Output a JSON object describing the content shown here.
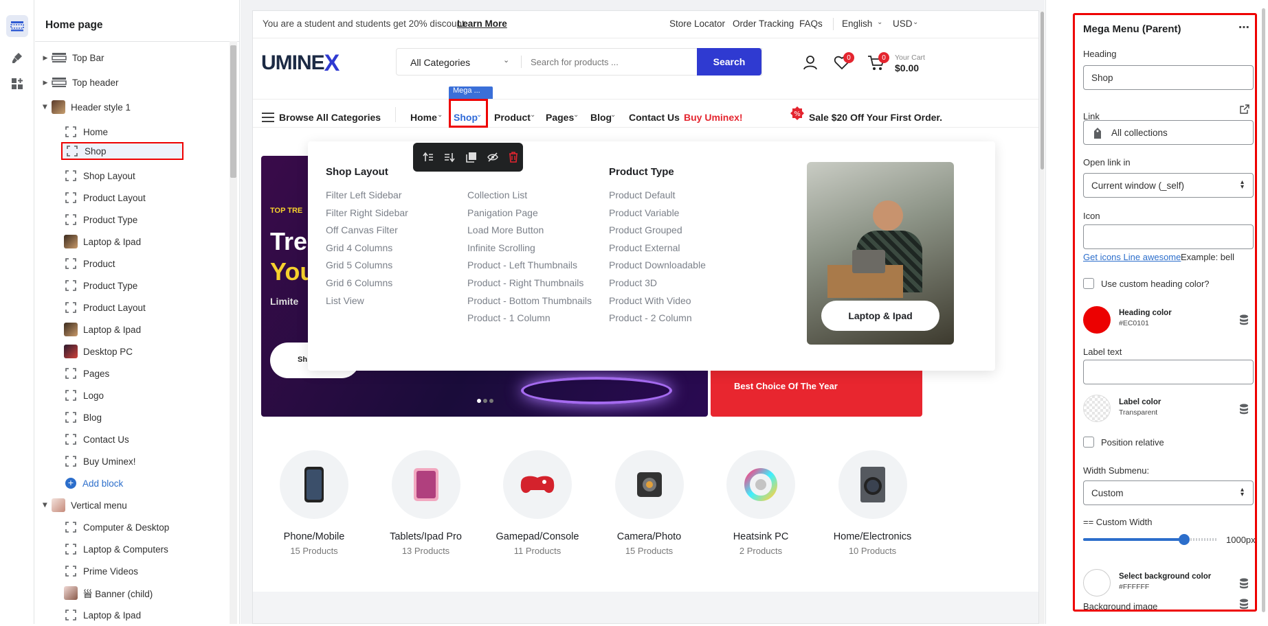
{
  "rail": {
    "icons": [
      "sections-icon",
      "theme-brush-icon",
      "apps-icon"
    ]
  },
  "tree": {
    "title": "Home page",
    "items": [
      {
        "label": "Top Bar",
        "type": "section"
      },
      {
        "label": "Top header",
        "type": "section"
      },
      {
        "label": "Header style 1",
        "type": "section-open"
      },
      {
        "label": "Home",
        "type": "block"
      },
      {
        "label": "Shop",
        "type": "block"
      },
      {
        "label": "Shop Layout",
        "type": "block"
      },
      {
        "label": "Product Layout",
        "type": "block"
      },
      {
        "label": "Product Type",
        "type": "block"
      },
      {
        "label": "Laptop & Ipad",
        "type": "image"
      },
      {
        "label": "Product",
        "type": "block"
      },
      {
        "label": "Product Type",
        "type": "block"
      },
      {
        "label": "Product Layout",
        "type": "block"
      },
      {
        "label": "Laptop & Ipad",
        "type": "image"
      },
      {
        "label": "Desktop PC",
        "type": "image"
      },
      {
        "label": "Pages",
        "type": "block"
      },
      {
        "label": "Logo",
        "type": "block"
      },
      {
        "label": "Blog",
        "type": "block"
      },
      {
        "label": "Contact Us",
        "type": "block"
      },
      {
        "label": "Buy Uminex!",
        "type": "block"
      },
      {
        "label": "Add block",
        "type": "add"
      },
      {
        "label": "Vertical menu",
        "type": "section-open"
      },
      {
        "label": "Computer & Desktop",
        "type": "block"
      },
      {
        "label": "Laptop & Computers",
        "type": "block"
      },
      {
        "label": "Prime Videos",
        "type": "block"
      },
      {
        "label": "⻡ Banner (child)",
        "type": "image"
      },
      {
        "label": "Laptop & Ipad",
        "type": "block"
      }
    ]
  },
  "store": {
    "topbar": {
      "promo": "You are a student and students get 20% discount.",
      "learn_more": "Learn More",
      "links": [
        "Store Locator",
        "Order Tracking",
        "FAQs"
      ],
      "language": "English",
      "currency": "USD"
    },
    "header": {
      "logo_left": "UMINE",
      "logo_right": "X",
      "category_select": "All Categories",
      "search_placeholder": "Search for products ...",
      "search_button": "Search",
      "wishlist_count": "0",
      "cart_count": "0",
      "cart_label": "Your Cart",
      "cart_total": "$0.00",
      "mega_tag": "Mega ..."
    },
    "nav": {
      "browse": "Browse All Categories",
      "items": [
        "Home",
        "Shop",
        "Product",
        "Pages",
        "Blog",
        "Contact Us",
        "Buy Uminex!"
      ],
      "sale": "Sale $20 Off Your First Order."
    },
    "mega": {
      "columns": [
        {
          "heading": "Shop Layout",
          "items": [
            "Filter Left Sidebar",
            "Filter Right Sidebar",
            "Off Canvas Filter",
            "Grid 4 Columns",
            "Grid 5 Columns",
            "Grid 6 Columns",
            "List View"
          ]
        },
        {
          "heading": "",
          "items": [
            "Collection List",
            "Panigation Page",
            "Load More Button",
            "Infinite Scrolling",
            "Product - Left Thumbnails",
            "Product - Right Thumbnails",
            "Product - Bottom Thumbnails",
            "Product - 1 Column"
          ]
        },
        {
          "heading": "Product Type",
          "items": [
            "Product Default",
            "Product Variable",
            "Product Grouped",
            "Product External",
            "Product Downloadable",
            "Product 3D",
            "Product With Video",
            "Product - 2 Column"
          ]
        }
      ],
      "promo_button": "Laptop & Ipad"
    },
    "hero": {
      "tag": "TOP TRE",
      "line1": "Tre",
      "line2": "You",
      "sub": "Limite",
      "shop_btn": "Sh"
    },
    "side_banner": "Best Choice Of The Year",
    "categories": [
      {
        "name": "Phone/Mobile",
        "count": "15 Products"
      },
      {
        "name": "Tablets/Ipad Pro",
        "count": "13 Products"
      },
      {
        "name": "Gamepad/Console",
        "count": "11 Products"
      },
      {
        "name": "Camera/Photo",
        "count": "15 Products"
      },
      {
        "name": "Heatsink PC",
        "count": "2 Products"
      },
      {
        "name": "Home/Electronics",
        "count": "10 Products"
      }
    ]
  },
  "settings": {
    "title": "Mega Menu (Parent)",
    "heading_label": "Heading",
    "heading_value": "Shop",
    "link_label": "Link",
    "link_value": "All collections",
    "open_label": "Open link in",
    "open_value": "Current window (_self)",
    "icon_label": "Icon",
    "icon_value": "",
    "icons_link": "Get icons Line awesome",
    "icons_example": "Example: bell",
    "custom_heading_color": "Use custom heading color?",
    "heading_color_label": "Heading color",
    "heading_color_value": "#EC0101",
    "label_text_label": "Label text",
    "label_color_label": "Label color",
    "label_color_value": "Transparent",
    "position_relative": "Position relative",
    "width_submenu_label": "Width Submenu:",
    "width_submenu_value": "Custom",
    "custom_width_label": "== Custom Width",
    "custom_width_value": "1000px",
    "custom_width_fraction": 0.75,
    "bg_color_label": "Select background color",
    "bg_color_value": "#FFFFFF",
    "bg_image_label": "Background image"
  },
  "colors": {
    "accent": "#2f3ad1",
    "selection": "#e00000",
    "heading_color": "#EC0101",
    "sale_red": "#e4252f"
  }
}
